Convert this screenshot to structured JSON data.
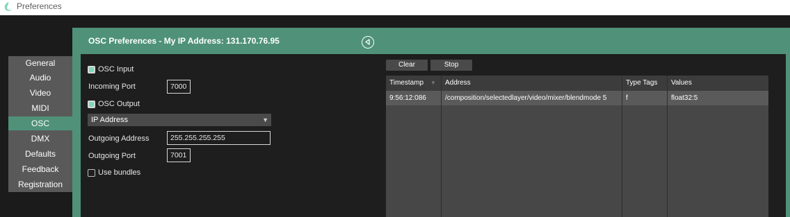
{
  "window": {
    "title": "Preferences"
  },
  "sidebar": {
    "items": [
      {
        "label": "General"
      },
      {
        "label": "Audio"
      },
      {
        "label": "Video"
      },
      {
        "label": "MIDI"
      },
      {
        "label": "OSC",
        "active": true
      },
      {
        "label": "DMX"
      },
      {
        "label": "Defaults"
      },
      {
        "label": "Feedback"
      },
      {
        "label": "Registration"
      }
    ]
  },
  "panel": {
    "title": "OSC Preferences - My IP Address: 131.170.76.95"
  },
  "osc": {
    "input_label": "OSC Input",
    "input_checked": true,
    "incoming_port_label": "Incoming Port",
    "incoming_port": "7000",
    "output_label": "OSC Output",
    "output_checked": true,
    "address_select": "IP Address",
    "outgoing_address_label": "Outgoing Address",
    "outgoing_address": "255.255.255.255",
    "outgoing_port_label": "Outgoing Port",
    "outgoing_port": "7001",
    "bundles_label": "Use bundles",
    "bundles_checked": false
  },
  "monitor": {
    "clear_label": "Clear",
    "stop_label": "Stop",
    "columns": [
      "Timestamp",
      "Address",
      "Type Tags",
      "Values"
    ],
    "rows": [
      [
        "9:56:12:086",
        "/composition/selectedlayer/video/mixer/blendmode 5",
        "f",
        "float32:5"
      ]
    ]
  },
  "colors": {
    "accent": "#4f9279",
    "checkbox_on": "#7ed9b8",
    "background": "#1e1e1e"
  }
}
